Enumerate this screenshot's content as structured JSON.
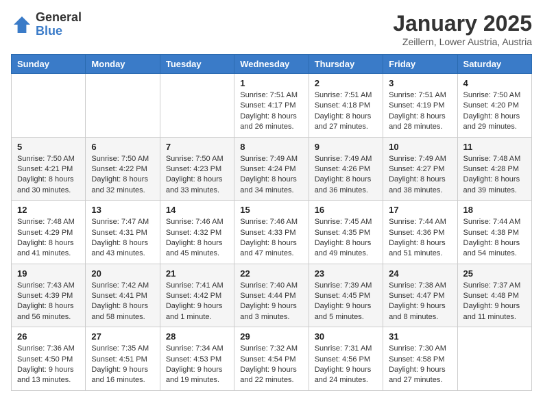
{
  "logo": {
    "general": "General",
    "blue": "Blue"
  },
  "title": "January 2025",
  "subtitle": "Zeillern, Lower Austria, Austria",
  "days_of_week": [
    "Sunday",
    "Monday",
    "Tuesday",
    "Wednesday",
    "Thursday",
    "Friday",
    "Saturday"
  ],
  "weeks": [
    [
      {
        "day": "",
        "info": ""
      },
      {
        "day": "",
        "info": ""
      },
      {
        "day": "",
        "info": ""
      },
      {
        "day": "1",
        "info": "Sunrise: 7:51 AM\nSunset: 4:17 PM\nDaylight: 8 hours and 26 minutes."
      },
      {
        "day": "2",
        "info": "Sunrise: 7:51 AM\nSunset: 4:18 PM\nDaylight: 8 hours and 27 minutes."
      },
      {
        "day": "3",
        "info": "Sunrise: 7:51 AM\nSunset: 4:19 PM\nDaylight: 8 hours and 28 minutes."
      },
      {
        "day": "4",
        "info": "Sunrise: 7:50 AM\nSunset: 4:20 PM\nDaylight: 8 hours and 29 minutes."
      }
    ],
    [
      {
        "day": "5",
        "info": "Sunrise: 7:50 AM\nSunset: 4:21 PM\nDaylight: 8 hours and 30 minutes."
      },
      {
        "day": "6",
        "info": "Sunrise: 7:50 AM\nSunset: 4:22 PM\nDaylight: 8 hours and 32 minutes."
      },
      {
        "day": "7",
        "info": "Sunrise: 7:50 AM\nSunset: 4:23 PM\nDaylight: 8 hours and 33 minutes."
      },
      {
        "day": "8",
        "info": "Sunrise: 7:49 AM\nSunset: 4:24 PM\nDaylight: 8 hours and 34 minutes."
      },
      {
        "day": "9",
        "info": "Sunrise: 7:49 AM\nSunset: 4:26 PM\nDaylight: 8 hours and 36 minutes."
      },
      {
        "day": "10",
        "info": "Sunrise: 7:49 AM\nSunset: 4:27 PM\nDaylight: 8 hours and 38 minutes."
      },
      {
        "day": "11",
        "info": "Sunrise: 7:48 AM\nSunset: 4:28 PM\nDaylight: 8 hours and 39 minutes."
      }
    ],
    [
      {
        "day": "12",
        "info": "Sunrise: 7:48 AM\nSunset: 4:29 PM\nDaylight: 8 hours and 41 minutes."
      },
      {
        "day": "13",
        "info": "Sunrise: 7:47 AM\nSunset: 4:31 PM\nDaylight: 8 hours and 43 minutes."
      },
      {
        "day": "14",
        "info": "Sunrise: 7:46 AM\nSunset: 4:32 PM\nDaylight: 8 hours and 45 minutes."
      },
      {
        "day": "15",
        "info": "Sunrise: 7:46 AM\nSunset: 4:33 PM\nDaylight: 8 hours and 47 minutes."
      },
      {
        "day": "16",
        "info": "Sunrise: 7:45 AM\nSunset: 4:35 PM\nDaylight: 8 hours and 49 minutes."
      },
      {
        "day": "17",
        "info": "Sunrise: 7:44 AM\nSunset: 4:36 PM\nDaylight: 8 hours and 51 minutes."
      },
      {
        "day": "18",
        "info": "Sunrise: 7:44 AM\nSunset: 4:38 PM\nDaylight: 8 hours and 54 minutes."
      }
    ],
    [
      {
        "day": "19",
        "info": "Sunrise: 7:43 AM\nSunset: 4:39 PM\nDaylight: 8 hours and 56 minutes."
      },
      {
        "day": "20",
        "info": "Sunrise: 7:42 AM\nSunset: 4:41 PM\nDaylight: 8 hours and 58 minutes."
      },
      {
        "day": "21",
        "info": "Sunrise: 7:41 AM\nSunset: 4:42 PM\nDaylight: 9 hours and 1 minute."
      },
      {
        "day": "22",
        "info": "Sunrise: 7:40 AM\nSunset: 4:44 PM\nDaylight: 9 hours and 3 minutes."
      },
      {
        "day": "23",
        "info": "Sunrise: 7:39 AM\nSunset: 4:45 PM\nDaylight: 9 hours and 5 minutes."
      },
      {
        "day": "24",
        "info": "Sunrise: 7:38 AM\nSunset: 4:47 PM\nDaylight: 9 hours and 8 minutes."
      },
      {
        "day": "25",
        "info": "Sunrise: 7:37 AM\nSunset: 4:48 PM\nDaylight: 9 hours and 11 minutes."
      }
    ],
    [
      {
        "day": "26",
        "info": "Sunrise: 7:36 AM\nSunset: 4:50 PM\nDaylight: 9 hours and 13 minutes."
      },
      {
        "day": "27",
        "info": "Sunrise: 7:35 AM\nSunset: 4:51 PM\nDaylight: 9 hours and 16 minutes."
      },
      {
        "day": "28",
        "info": "Sunrise: 7:34 AM\nSunset: 4:53 PM\nDaylight: 9 hours and 19 minutes."
      },
      {
        "day": "29",
        "info": "Sunrise: 7:32 AM\nSunset: 4:54 PM\nDaylight: 9 hours and 22 minutes."
      },
      {
        "day": "30",
        "info": "Sunrise: 7:31 AM\nSunset: 4:56 PM\nDaylight: 9 hours and 24 minutes."
      },
      {
        "day": "31",
        "info": "Sunrise: 7:30 AM\nSunset: 4:58 PM\nDaylight: 9 hours and 27 minutes."
      },
      {
        "day": "",
        "info": ""
      }
    ]
  ]
}
